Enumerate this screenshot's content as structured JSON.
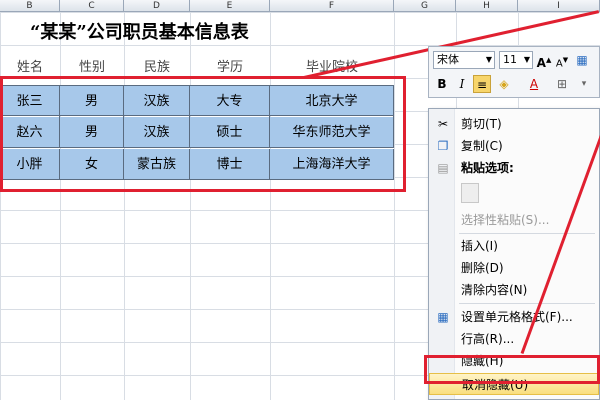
{
  "columns": [
    "B",
    "C",
    "D",
    "E",
    "F",
    "G",
    "H",
    "I"
  ],
  "sheet": {
    "title": "“某某”公司职员基本信息表",
    "headers": [
      "姓名",
      "性别",
      "民族",
      "学历",
      "毕业院校"
    ],
    "rows": [
      [
        "张三",
        "男",
        "汉族",
        "大专",
        "北京大学"
      ],
      [
        "赵六",
        "男",
        "汉族",
        "硕士",
        "华东师范大学"
      ],
      [
        "小胖",
        "女",
        "蒙古族",
        "博士",
        "上海海洋大学"
      ]
    ]
  },
  "toolbar": {
    "font": "宋体",
    "size": "11",
    "grow": "A",
    "shrink": "A",
    "bold": "B",
    "italic": "I",
    "font_color": "A"
  },
  "menu": {
    "cut": "剪切(T)",
    "copy": "复制(C)",
    "paste_options": "粘贴选项:",
    "paste_special": "选择性粘贴(S)...",
    "insert": "插入(I)",
    "delete": "删除(D)",
    "clear": "清除内容(N)",
    "format_cells": "设置单元格格式(F)...",
    "row_height": "行高(R)...",
    "hide": "隐藏(H)",
    "unhide": "取消隐藏(U)"
  },
  "colors": {
    "selection": "#a7c8ea",
    "annotation": "#e02030",
    "highlight": "#f9de7e"
  }
}
